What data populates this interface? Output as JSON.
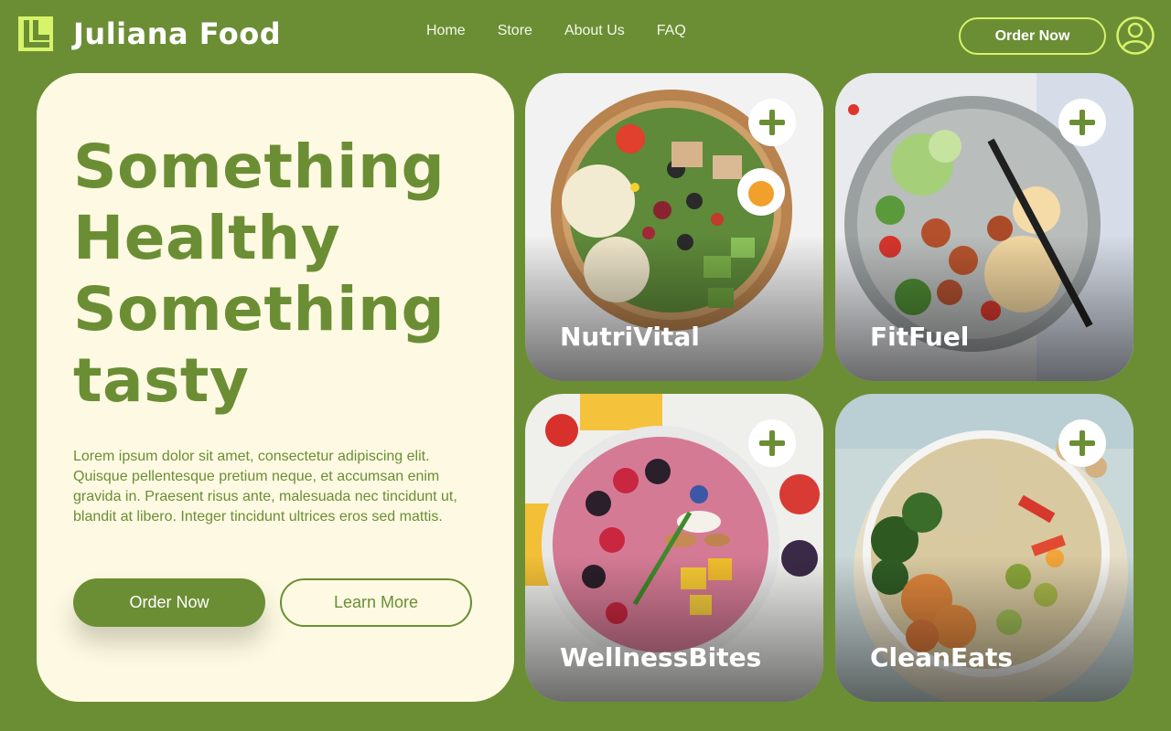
{
  "brand": {
    "name": "Juliana Food",
    "accent": "#d6f36a",
    "primary": "#6b8e35",
    "cream": "#fdf9e2"
  },
  "nav": {
    "items": [
      "Home",
      "Store",
      "About Us",
      "FAQ"
    ]
  },
  "header": {
    "order_label": "Order Now"
  },
  "hero": {
    "title_lines": [
      "Something",
      "Healthy",
      "Something",
      "tasty"
    ],
    "description": "Lorem ipsum dolor sit amet, consectetur adipiscing elit. Quisque pellentesque pretium neque, et accumsan enim gravida in. Praesent risus ante, malesuada nec tincidunt ut, blandit at libero. Integer tincidunt ultrices eros sed mattis.",
    "primary_button": "Order Now",
    "secondary_button": "Learn More"
  },
  "products": [
    {
      "name": "NutriVital",
      "icon": "plus-icon"
    },
    {
      "name": "FitFuel",
      "icon": "plus-icon"
    },
    {
      "name": "WellnessBites",
      "icon": "plus-icon"
    },
    {
      "name": "CleanEats",
      "icon": "plus-icon"
    }
  ]
}
